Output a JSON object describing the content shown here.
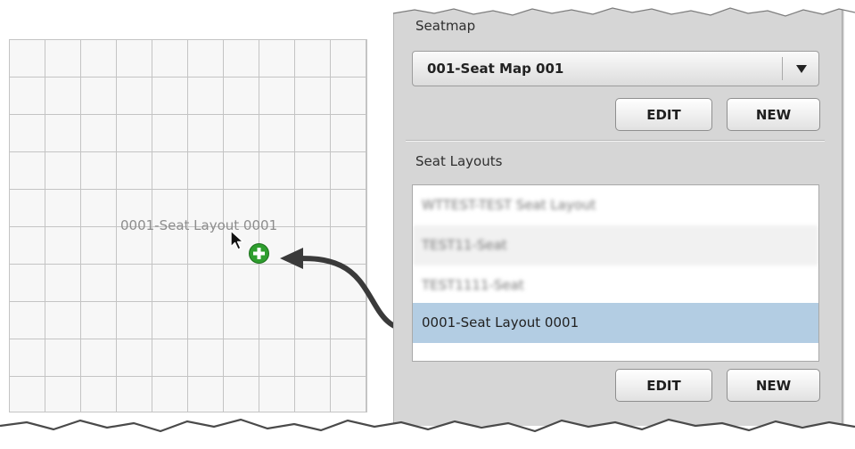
{
  "canvas": {
    "drop_label": "0001-Seat Layout 0001"
  },
  "seatmap": {
    "title": "Seatmap",
    "selected_value": "001-Seat Map 001",
    "edit_label": "EDIT",
    "new_label": "NEW"
  },
  "seat_layouts": {
    "title": "Seat Layouts",
    "items": [
      {
        "label": "WTTEST-TEST Seat Layout",
        "obscured": true
      },
      {
        "label": "TEST11-Seat",
        "obscured": true
      },
      {
        "label": "TEST1111-Seat",
        "obscured": true
      },
      {
        "label": "0001-Seat Layout 0001",
        "selected": true
      }
    ],
    "edit_label": "EDIT",
    "new_label": "NEW"
  },
  "colors": {
    "selected_row": "#b3cde3",
    "panel_bg": "#d6d6d6",
    "add_icon": "#2e9e2e"
  },
  "icons": [
    "cursor-pointer-icon",
    "add-icon",
    "chevron-down-icon",
    "drag-arrow-icon"
  ]
}
